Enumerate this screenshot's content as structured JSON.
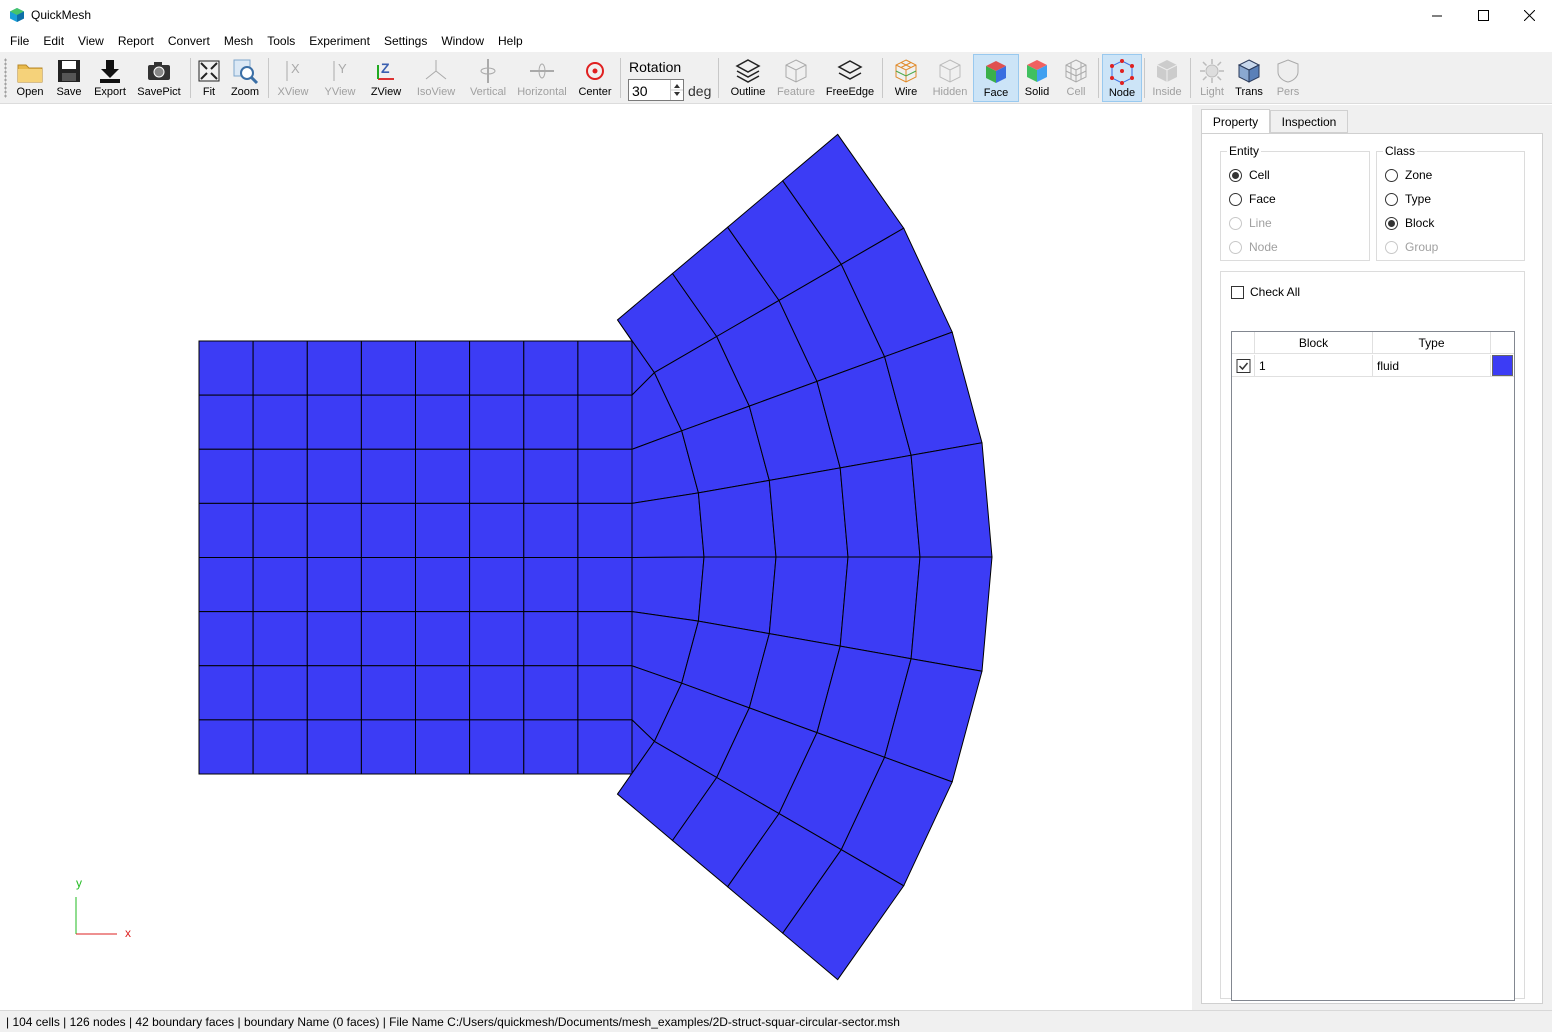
{
  "window": {
    "title": "QuickMesh"
  },
  "menu": [
    "File",
    "Edit",
    "View",
    "Report",
    "Convert",
    "Mesh",
    "Tools",
    "Experiment",
    "Settings",
    "Window",
    "Help"
  ],
  "toolbar": {
    "open": "Open",
    "save": "Save",
    "export": "Export",
    "savepict": "SavePict",
    "fit": "Fit",
    "zoom": "Zoom",
    "xview": "XView",
    "yview": "YView",
    "zview": "ZView",
    "isoview": "IsoView",
    "vertical": "Vertical",
    "horizontal": "Horizontal",
    "center": "Center",
    "rotation_label": "Rotation",
    "rotation_value": "30",
    "rotation_unit": "deg",
    "outline": "Outline",
    "feature": "Feature",
    "freeedge": "FreeEdge",
    "wire": "Wire",
    "hidden": "Hidden",
    "face": "Face",
    "solid": "Solid",
    "cell": "Cell",
    "node": "Node",
    "inside": "Inside",
    "light": "Light",
    "trans": "Trans",
    "pers": "Pers",
    "active_tools": [
      "Face",
      "Node"
    ]
  },
  "viewport": {
    "mesh_color": "#3c3cf5",
    "axis": {
      "y_label": "y",
      "x_label": "x",
      "y_color": "#22bb22",
      "x_color": "#dd2222"
    }
  },
  "panel": {
    "tabs": [
      "Property",
      "Inspection"
    ],
    "selected_tab": "Property",
    "entity": {
      "title": "Entity",
      "options": [
        "Cell",
        "Face",
        "Line",
        "Node"
      ],
      "selected": "Cell",
      "disabled": [
        "Line",
        "Node"
      ]
    },
    "class": {
      "title": "Class",
      "options": [
        "Zone",
        "Type",
        "Block",
        "Group"
      ],
      "selected": "Block",
      "disabled": [
        "Group"
      ]
    },
    "check_all": "Check All",
    "table": {
      "headers": [
        "Block",
        "Type"
      ],
      "rows": [
        {
          "checked": true,
          "block": "1",
          "type": "fluid",
          "color": "#3c3cf5"
        }
      ]
    }
  },
  "status": "| 104 cells | 126 nodes | 42 boundary faces |  boundary Name  (0 faces) | File Name C:/Users/quickmesh/Documents/mesh_examples/2D-struct-squar-circular-sector.msh"
}
